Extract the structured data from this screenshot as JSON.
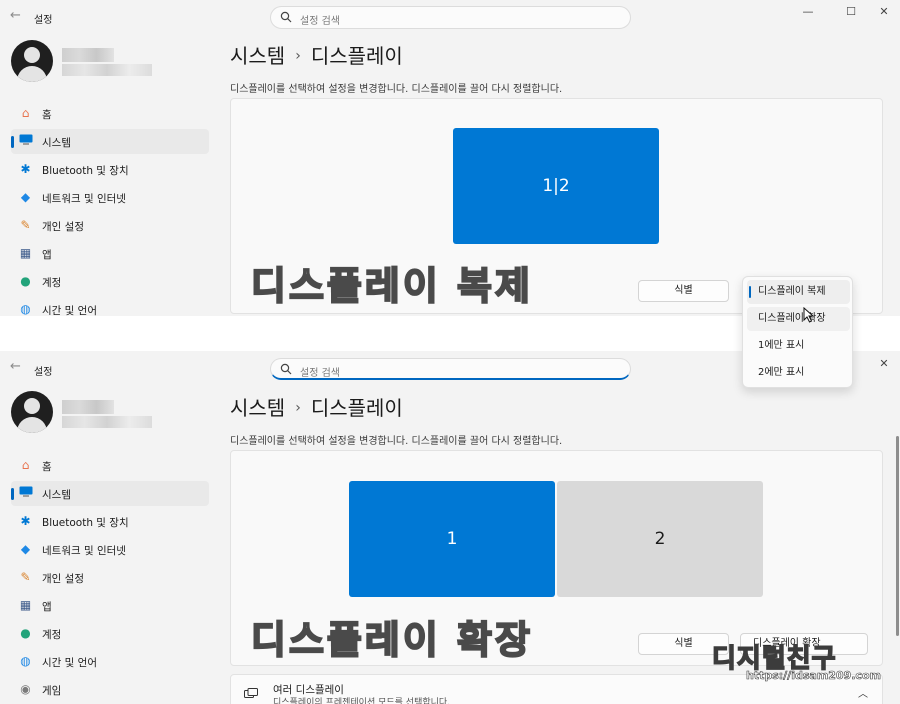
{
  "app": {
    "title": "설정",
    "back_icon": "back-arrow-icon"
  },
  "search": {
    "placeholder": "설정 검색"
  },
  "window_controls": [
    "minimize-icon",
    "maximize-icon",
    "close-icon"
  ],
  "sidebar": {
    "items": [
      {
        "label": "홈",
        "icon": "home-icon",
        "color": "#e8744f"
      },
      {
        "label": "시스템",
        "icon": "system-icon",
        "color": "#0078d4"
      },
      {
        "label": "Bluetooth 및 장치",
        "icon": "bluetooth-icon",
        "color": "#0078d4"
      },
      {
        "label": "네트워크 및 인터넷",
        "icon": "wifi-icon",
        "color": "#1e88e5"
      },
      {
        "label": "개인 설정",
        "icon": "brush-icon",
        "color": "#d9822b"
      },
      {
        "label": "앱",
        "icon": "apps-icon",
        "color": "#3c5a8a"
      },
      {
        "label": "계정",
        "icon": "account-icon",
        "color": "#22a37a"
      },
      {
        "label": "시간 및 언어",
        "icon": "globe-clock-icon",
        "color": "#1e88e5"
      },
      {
        "label": "게임",
        "icon": "gamepad-icon",
        "color": "#7a7a7a"
      }
    ]
  },
  "breadcrumb": {
    "parent": "시스템",
    "separator": "›",
    "current": "디스플레이"
  },
  "description": "디스플레이를 선택하여 설정을 변경합니다. 디스플레이를 끌어 다시 정렬합니다.",
  "top_view": {
    "monitor_label": "1|2",
    "identify_button": "식별",
    "watermark": "디스플레이 복제",
    "dropdown_options": [
      "디스플레이 복제",
      "디스플레이 확장",
      "1에만 표시",
      "2에만 표시"
    ],
    "dropdown_selected": "디스플레이 복제"
  },
  "bottom_view": {
    "monitor_1": "1",
    "monitor_2": "2",
    "identify_button": "식별",
    "dropdown_value": "디스플레이 확장",
    "watermark": "디스플레이 확장",
    "card_title": "여러 디스플레이",
    "card_subtitle": "디스플레이의 프레젠테이션 모드를 선택합니다."
  },
  "logo": {
    "main": "디지털친구 ",
    "url": "https://idsam209.com"
  },
  "colors": {
    "accent": "#0078d4",
    "selected_bar": "#0067c0"
  }
}
